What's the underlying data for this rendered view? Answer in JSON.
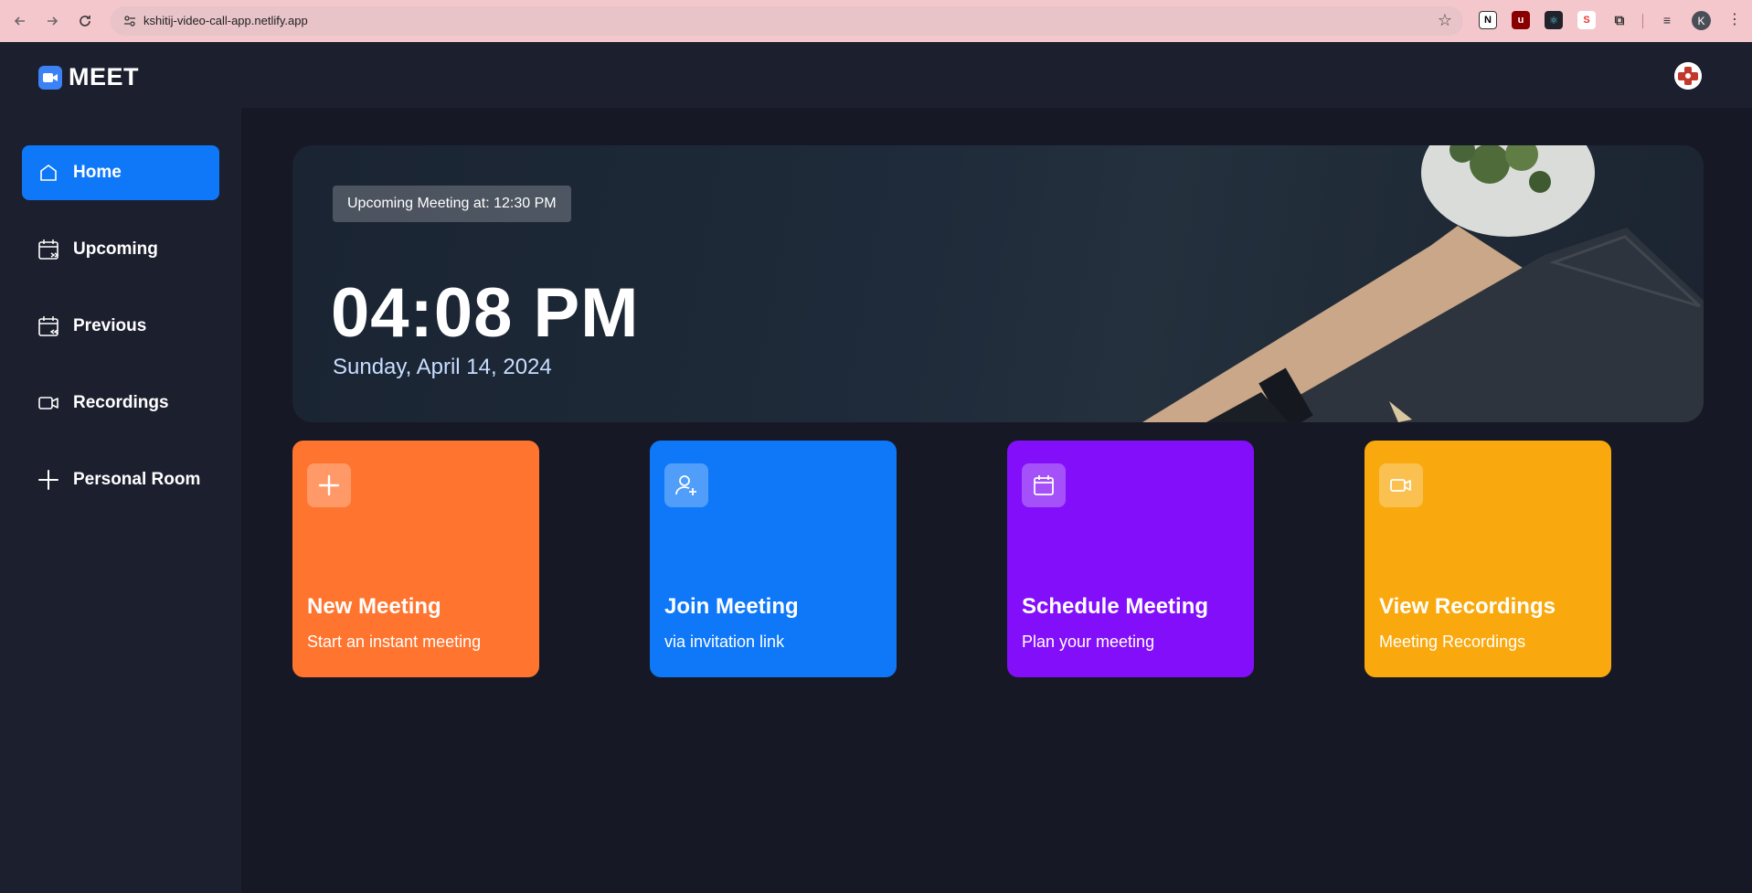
{
  "browser": {
    "url": "kshitij-video-call-app.netlify.app",
    "profile_initial": "K"
  },
  "app": {
    "logo_text": "MEET"
  },
  "sidebar": {
    "items": [
      {
        "label": "Home",
        "icon": "home-icon"
      },
      {
        "label": "Upcoming",
        "icon": "calendar-upcoming-icon"
      },
      {
        "label": "Previous",
        "icon": "calendar-previous-icon"
      },
      {
        "label": "Recordings",
        "icon": "video-icon"
      },
      {
        "label": "Personal Room",
        "icon": "plus-icon"
      }
    ]
  },
  "hero": {
    "upcoming": "Upcoming Meeting at: 12:30 PM",
    "time": "04:08 PM",
    "date": "Sunday, April 14, 2024"
  },
  "cards": [
    {
      "title": "New Meeting",
      "subtitle": "Start an instant meeting",
      "color": "#ff742e",
      "icon": "plus-icon"
    },
    {
      "title": "Join Meeting",
      "subtitle": "via invitation link",
      "color": "#0e78f9",
      "icon": "user-add-icon"
    },
    {
      "title": "Schedule Meeting",
      "subtitle": "Plan your meeting",
      "color": "#830ef9",
      "icon": "calendar-icon"
    },
    {
      "title": "View Recordings",
      "subtitle": "Meeting Recordings",
      "color": "#f9a90e",
      "icon": "video-icon"
    }
  ],
  "colors": {
    "background": "#161925",
    "panel": "#1c1f2e",
    "accent": "#0e78f9"
  }
}
